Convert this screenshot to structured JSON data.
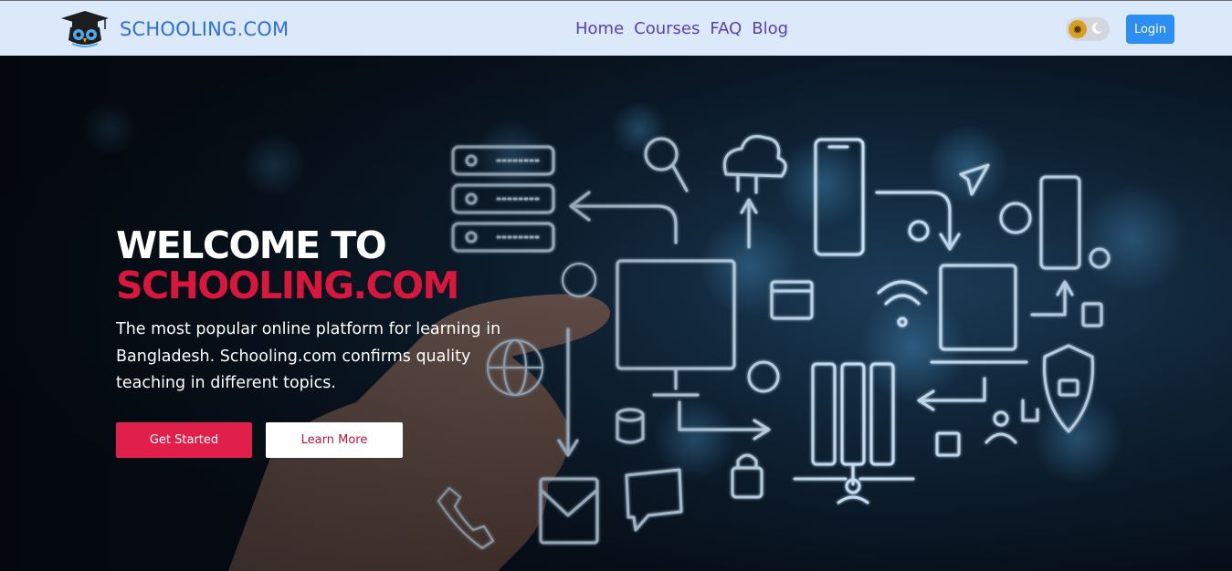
{
  "header": {
    "brand_name": "SCHOOLING.COM",
    "nav": [
      {
        "label": "Home"
      },
      {
        "label": "Courses"
      },
      {
        "label": "FAQ"
      },
      {
        "label": "Blog"
      }
    ],
    "login_label": "Login"
  },
  "hero": {
    "title_line1": "WELCOME TO",
    "title_line2": "SCHOOLING.COM",
    "description": "The most popular online platform for learning in Bangladesh. Schooling.com confirms quality teaching in different topics.",
    "primary_button": "Get Started",
    "secondary_button": "Learn More"
  },
  "colors": {
    "navbar_bg": "#dce9fb",
    "brand_blue": "#2f6fd6",
    "nav_link": "#5b3fb0",
    "login_bg": "#2b8ef0",
    "accent_red": "#d9173d",
    "primary_button_bg": "#e0204a"
  },
  "icons": [
    "owl-graduate-logo-icon",
    "sun-icon",
    "moon-icon"
  ]
}
